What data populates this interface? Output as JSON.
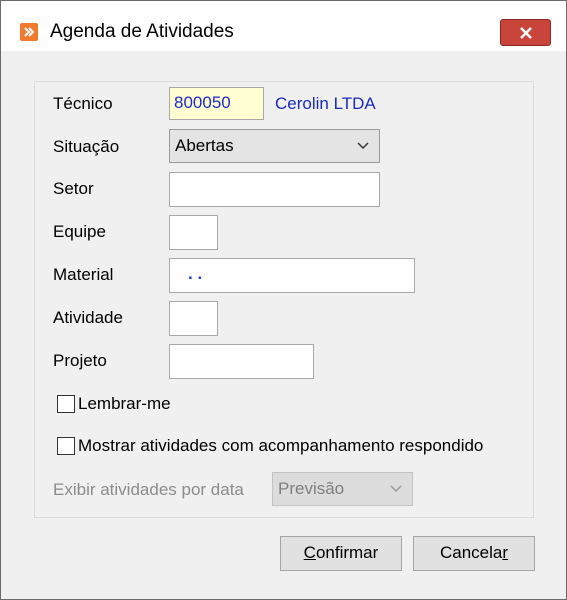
{
  "window": {
    "title": "Agenda de Atividades",
    "app_icon": "app-logo-icon",
    "close_icon": "close-icon"
  },
  "form": {
    "tecnico": {
      "label": "Técnico",
      "code": "800050",
      "name": "Cerolin LTDA"
    },
    "situacao": {
      "label": "Situação",
      "value": "Abertas"
    },
    "setor": {
      "label": "Setor",
      "value": ""
    },
    "equipe": {
      "label": "Equipe",
      "value": ""
    },
    "material": {
      "label": "Material",
      "value": ".  ."
    },
    "atividade": {
      "label": "Atividade",
      "value": ""
    },
    "projeto": {
      "label": "Projeto",
      "value": ""
    },
    "lembrar": {
      "label": "Lembrar-me",
      "checked": false
    },
    "mostrar": {
      "label": "Mostrar atividades com acompanhamento respondido",
      "checked": false
    },
    "exibir": {
      "label": "Exibir atividades por data",
      "value": "Previsão",
      "enabled": false
    }
  },
  "buttons": {
    "confirm_pre": "",
    "confirm_u": "C",
    "confirm_rest": "onfirmar",
    "cancel_pre": "Cancela",
    "cancel_u": "r",
    "cancel_rest": ""
  },
  "colors": {
    "code_field_bg": "#ffffd1",
    "link_text": "#1a2bb8",
    "close_button": "#c9443b"
  }
}
